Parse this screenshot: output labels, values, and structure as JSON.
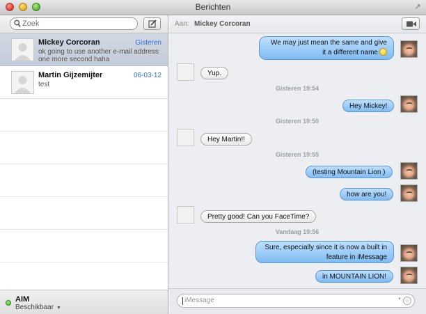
{
  "window": {
    "title": "Berichten"
  },
  "sidebar": {
    "search_placeholder": "Zoek",
    "conversations": [
      {
        "name": "Mickey Corcoran",
        "date": "Gisteren",
        "preview": "ok going to use another e-mail address one more second haha",
        "selected": true
      },
      {
        "name": "Martin Gijzemijter",
        "date": "06-03-12",
        "preview": "test",
        "selected": false
      }
    ],
    "account": {
      "service": "AIM",
      "status": "Beschikbaar"
    }
  },
  "chat": {
    "to_label": "Aan:",
    "to_name": "Mickey Corcoran",
    "messages": [
      {
        "kind": "out",
        "text": "We may just mean the same and give it a different name",
        "emoji": "smile-emoji"
      },
      {
        "kind": "in",
        "text": "Yup."
      },
      {
        "kind": "time",
        "text": "Gisteren 19:54"
      },
      {
        "kind": "out",
        "text": "Hey Mickey!"
      },
      {
        "kind": "time",
        "text": "Gisteren 19:50"
      },
      {
        "kind": "in",
        "text": "Hey Martin!!"
      },
      {
        "kind": "time",
        "text": "Gisteren 19:55"
      },
      {
        "kind": "out",
        "text": "(testing Mountain Lion )"
      },
      {
        "kind": "out",
        "text": "how are you!"
      },
      {
        "kind": "in",
        "text": "Pretty good! Can you FaceTime?"
      },
      {
        "kind": "time",
        "text": "Vandaag 19:56"
      },
      {
        "kind": "out",
        "text": "Sure, especially since it is now a built in feature in iMessage"
      },
      {
        "kind": "out",
        "text": "in MOUNTAIN LION!"
      }
    ],
    "input_placeholder": "iMessage"
  },
  "colors": {
    "outgoing_bubble": "#7fbbf2",
    "incoming_bubble": "#ffffff",
    "date_accent": "#2a6fd0",
    "online_status": "#3fae1f"
  }
}
